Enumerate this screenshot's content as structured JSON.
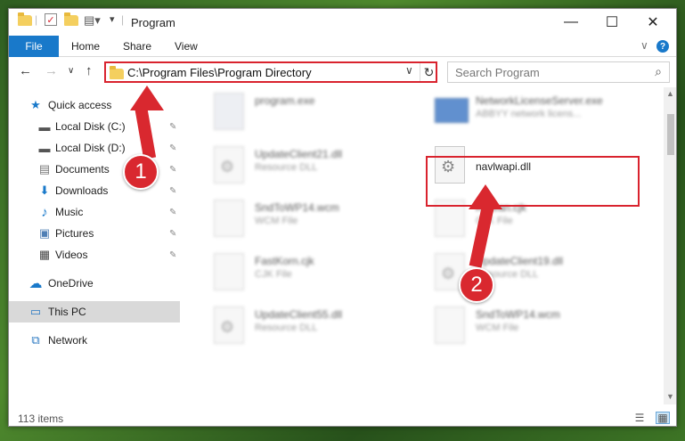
{
  "window": {
    "title": "Program",
    "minimize_icon": "minimize-icon",
    "maximize_icon": "maximize-icon",
    "close_icon": "close-icon"
  },
  "ribbon": {
    "tabs": [
      {
        "label": "File"
      },
      {
        "label": "Home"
      },
      {
        "label": "Share"
      },
      {
        "label": "View"
      }
    ],
    "expand_glyph": "∨",
    "help_glyph": "?"
  },
  "nav": {
    "back_glyph": "←",
    "forward_glyph": "→",
    "recent_glyph": "∨",
    "up_glyph": "↑",
    "address": "C:\\Program Files\\Program Directory",
    "address_chevron": "∨",
    "refresh_glyph": "↻",
    "search_placeholder": "Search Program",
    "search_glyph": "⌕"
  },
  "sidebar": {
    "items": [
      {
        "label": "Quick access",
        "icon": "star-icon",
        "glyph": "★"
      },
      {
        "label": "Local Disk (C:)",
        "icon": "drive-icon",
        "glyph": "▬"
      },
      {
        "label": "Local Disk (D:)",
        "icon": "drive-icon",
        "glyph": "▬"
      },
      {
        "label": "Documents",
        "icon": "documents-icon",
        "glyph": "▤"
      },
      {
        "label": "Downloads",
        "icon": "downloads-icon",
        "glyph": "⬇"
      },
      {
        "label": "Music",
        "icon": "music-icon",
        "glyph": "♪"
      },
      {
        "label": "Pictures",
        "icon": "pictures-icon",
        "glyph": "▣"
      },
      {
        "label": "Videos",
        "icon": "videos-icon",
        "glyph": "▦"
      },
      {
        "label": "OneDrive",
        "icon": "cloud-icon",
        "glyph": "☁"
      },
      {
        "label": "This PC",
        "icon": "computer-icon",
        "glyph": "▭"
      },
      {
        "label": "Network",
        "icon": "network-icon",
        "glyph": "⧉"
      }
    ],
    "pin_glyph": "✎"
  },
  "files": [
    {
      "name": "program.exe",
      "type": ""
    },
    {
      "name": "NetworkLicenseServer.exe",
      "type": "ABBYY network licens..."
    },
    {
      "name": "UpdateClient21.dll",
      "type": "Resource DLL"
    },
    {
      "name": "navlwapi.dll",
      "type": ""
    },
    {
      "name": "SndToWP14.wcm",
      "type": "WCM File"
    },
    {
      "name": "Korean.cjk",
      "type": "CJK File"
    },
    {
      "name": "FastKorn.cjk",
      "type": "CJK File"
    },
    {
      "name": "UpdateClient19.dll",
      "type": "Resource DLL"
    },
    {
      "name": "UpdateClient55.dll",
      "type": "Resource DLL"
    },
    {
      "name": "SndToWP14.wcm",
      "type": "WCM File"
    }
  ],
  "file_icon_glyph": "⚙",
  "status": {
    "items_count": "113 items",
    "details_view_glyph": "☰",
    "tiles_view_glyph": "▦"
  },
  "annotations": {
    "step1": "1",
    "step2": "2",
    "highlight_color": "#d9232e"
  },
  "colors": {
    "accent": "#1979ca",
    "selection": "#d9d9d9"
  }
}
